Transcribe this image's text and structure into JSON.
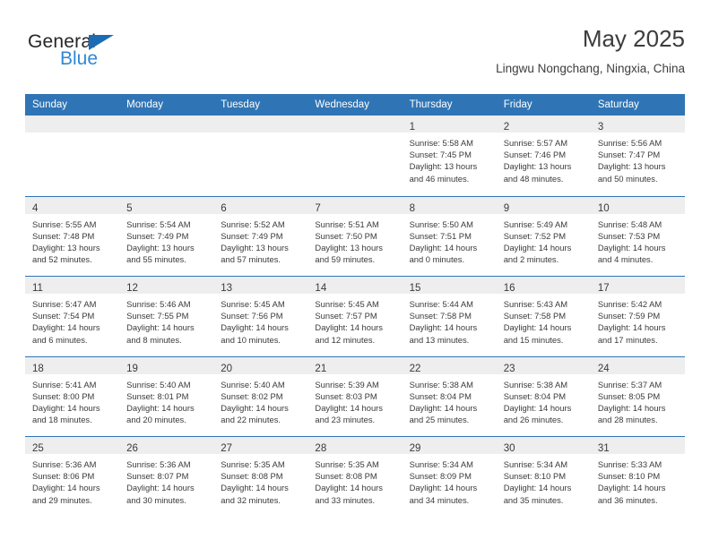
{
  "brand": {
    "name_dark": "General",
    "name_blue": "Blue",
    "triangle_icon": "triangle-logo-icon",
    "accent_color": "#2f75b6"
  },
  "header": {
    "title": "May 2025",
    "subtitle": "Lingwu Nongchang, Ningxia, China"
  },
  "calendar": {
    "weekday_headers": [
      "Sunday",
      "Monday",
      "Tuesday",
      "Wednesday",
      "Thursday",
      "Friday",
      "Saturday"
    ],
    "header_bg": "#2f75b6",
    "header_text": "#ffffff",
    "day_strip_bg": "#eeeeee",
    "weeks": [
      [
        {
          "day": "",
          "lines": []
        },
        {
          "day": "",
          "lines": []
        },
        {
          "day": "",
          "lines": []
        },
        {
          "day": "",
          "lines": []
        },
        {
          "day": "1",
          "lines": [
            "Sunrise: 5:58 AM",
            "Sunset: 7:45 PM",
            "Daylight: 13 hours",
            "and 46 minutes."
          ]
        },
        {
          "day": "2",
          "lines": [
            "Sunrise: 5:57 AM",
            "Sunset: 7:46 PM",
            "Daylight: 13 hours",
            "and 48 minutes."
          ]
        },
        {
          "day": "3",
          "lines": [
            "Sunrise: 5:56 AM",
            "Sunset: 7:47 PM",
            "Daylight: 13 hours",
            "and 50 minutes."
          ]
        }
      ],
      [
        {
          "day": "4",
          "lines": [
            "Sunrise: 5:55 AM",
            "Sunset: 7:48 PM",
            "Daylight: 13 hours",
            "and 52 minutes."
          ]
        },
        {
          "day": "5",
          "lines": [
            "Sunrise: 5:54 AM",
            "Sunset: 7:49 PM",
            "Daylight: 13 hours",
            "and 55 minutes."
          ]
        },
        {
          "day": "6",
          "lines": [
            "Sunrise: 5:52 AM",
            "Sunset: 7:49 PM",
            "Daylight: 13 hours",
            "and 57 minutes."
          ]
        },
        {
          "day": "7",
          "lines": [
            "Sunrise: 5:51 AM",
            "Sunset: 7:50 PM",
            "Daylight: 13 hours",
            "and 59 minutes."
          ]
        },
        {
          "day": "8",
          "lines": [
            "Sunrise: 5:50 AM",
            "Sunset: 7:51 PM",
            "Daylight: 14 hours",
            "and 0 minutes."
          ]
        },
        {
          "day": "9",
          "lines": [
            "Sunrise: 5:49 AM",
            "Sunset: 7:52 PM",
            "Daylight: 14 hours",
            "and 2 minutes."
          ]
        },
        {
          "day": "10",
          "lines": [
            "Sunrise: 5:48 AM",
            "Sunset: 7:53 PM",
            "Daylight: 14 hours",
            "and 4 minutes."
          ]
        }
      ],
      [
        {
          "day": "11",
          "lines": [
            "Sunrise: 5:47 AM",
            "Sunset: 7:54 PM",
            "Daylight: 14 hours",
            "and 6 minutes."
          ]
        },
        {
          "day": "12",
          "lines": [
            "Sunrise: 5:46 AM",
            "Sunset: 7:55 PM",
            "Daylight: 14 hours",
            "and 8 minutes."
          ]
        },
        {
          "day": "13",
          "lines": [
            "Sunrise: 5:45 AM",
            "Sunset: 7:56 PM",
            "Daylight: 14 hours",
            "and 10 minutes."
          ]
        },
        {
          "day": "14",
          "lines": [
            "Sunrise: 5:45 AM",
            "Sunset: 7:57 PM",
            "Daylight: 14 hours",
            "and 12 minutes."
          ]
        },
        {
          "day": "15",
          "lines": [
            "Sunrise: 5:44 AM",
            "Sunset: 7:58 PM",
            "Daylight: 14 hours",
            "and 13 minutes."
          ]
        },
        {
          "day": "16",
          "lines": [
            "Sunrise: 5:43 AM",
            "Sunset: 7:58 PM",
            "Daylight: 14 hours",
            "and 15 minutes."
          ]
        },
        {
          "day": "17",
          "lines": [
            "Sunrise: 5:42 AM",
            "Sunset: 7:59 PM",
            "Daylight: 14 hours",
            "and 17 minutes."
          ]
        }
      ],
      [
        {
          "day": "18",
          "lines": [
            "Sunrise: 5:41 AM",
            "Sunset: 8:00 PM",
            "Daylight: 14 hours",
            "and 18 minutes."
          ]
        },
        {
          "day": "19",
          "lines": [
            "Sunrise: 5:40 AM",
            "Sunset: 8:01 PM",
            "Daylight: 14 hours",
            "and 20 minutes."
          ]
        },
        {
          "day": "20",
          "lines": [
            "Sunrise: 5:40 AM",
            "Sunset: 8:02 PM",
            "Daylight: 14 hours",
            "and 22 minutes."
          ]
        },
        {
          "day": "21",
          "lines": [
            "Sunrise: 5:39 AM",
            "Sunset: 8:03 PM",
            "Daylight: 14 hours",
            "and 23 minutes."
          ]
        },
        {
          "day": "22",
          "lines": [
            "Sunrise: 5:38 AM",
            "Sunset: 8:04 PM",
            "Daylight: 14 hours",
            "and 25 minutes."
          ]
        },
        {
          "day": "23",
          "lines": [
            "Sunrise: 5:38 AM",
            "Sunset: 8:04 PM",
            "Daylight: 14 hours",
            "and 26 minutes."
          ]
        },
        {
          "day": "24",
          "lines": [
            "Sunrise: 5:37 AM",
            "Sunset: 8:05 PM",
            "Daylight: 14 hours",
            "and 28 minutes."
          ]
        }
      ],
      [
        {
          "day": "25",
          "lines": [
            "Sunrise: 5:36 AM",
            "Sunset: 8:06 PM",
            "Daylight: 14 hours",
            "and 29 minutes."
          ]
        },
        {
          "day": "26",
          "lines": [
            "Sunrise: 5:36 AM",
            "Sunset: 8:07 PM",
            "Daylight: 14 hours",
            "and 30 minutes."
          ]
        },
        {
          "day": "27",
          "lines": [
            "Sunrise: 5:35 AM",
            "Sunset: 8:08 PM",
            "Daylight: 14 hours",
            "and 32 minutes."
          ]
        },
        {
          "day": "28",
          "lines": [
            "Sunrise: 5:35 AM",
            "Sunset: 8:08 PM",
            "Daylight: 14 hours",
            "and 33 minutes."
          ]
        },
        {
          "day": "29",
          "lines": [
            "Sunrise: 5:34 AM",
            "Sunset: 8:09 PM",
            "Daylight: 14 hours",
            "and 34 minutes."
          ]
        },
        {
          "day": "30",
          "lines": [
            "Sunrise: 5:34 AM",
            "Sunset: 8:10 PM",
            "Daylight: 14 hours",
            "and 35 minutes."
          ]
        },
        {
          "day": "31",
          "lines": [
            "Sunrise: 5:33 AM",
            "Sunset: 8:10 PM",
            "Daylight: 14 hours",
            "and 36 minutes."
          ]
        }
      ]
    ]
  }
}
